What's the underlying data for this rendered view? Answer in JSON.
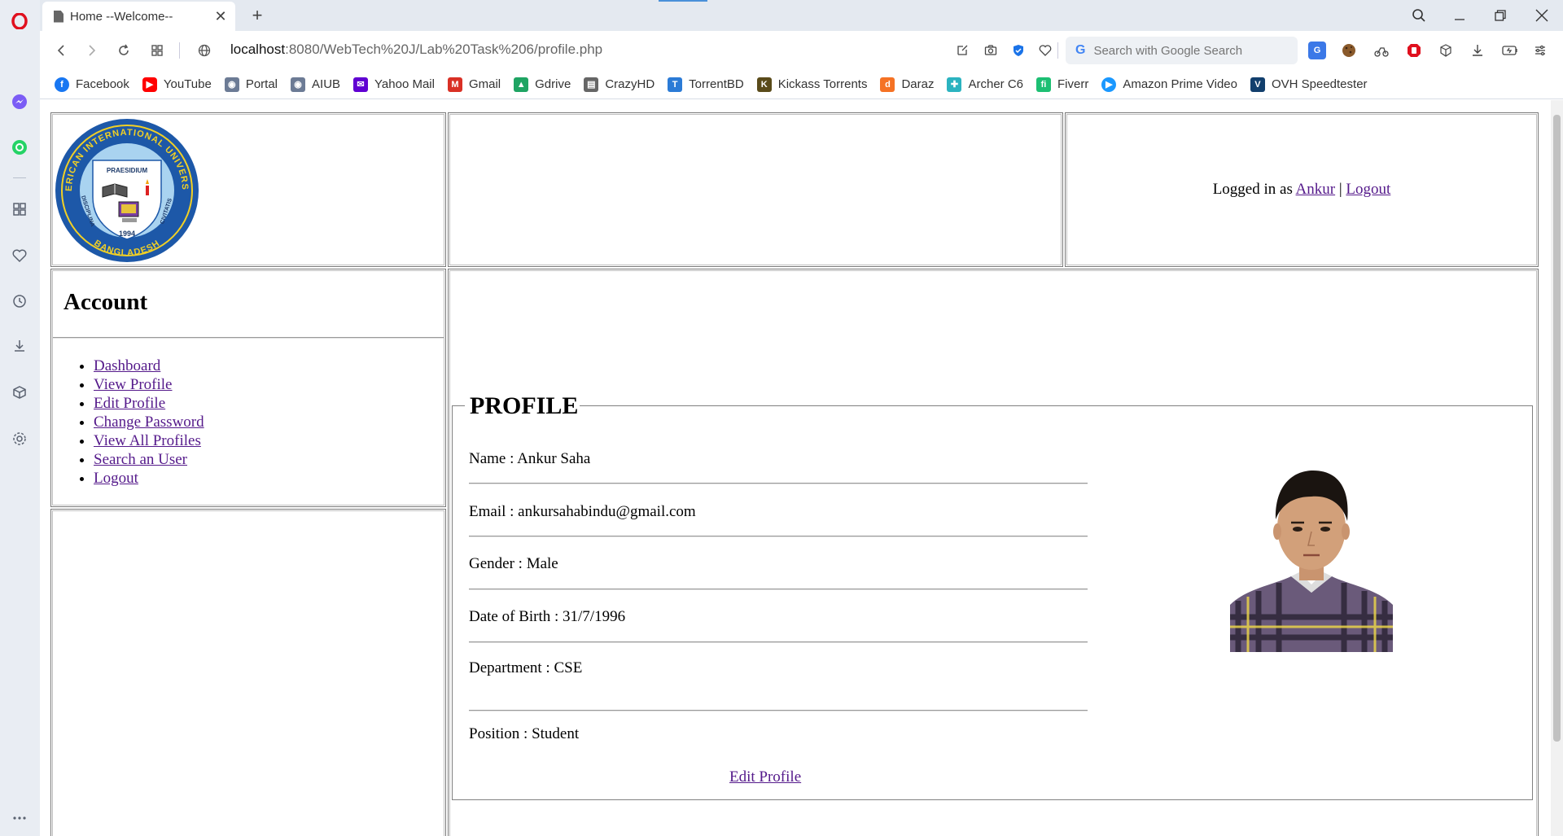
{
  "browser": {
    "tab_title": "Home --Welcome--",
    "url_host": "localhost",
    "url_path": ":8080/WebTech%20J/Lab%20Task%206/profile.php",
    "search_placeholder": "Search with Google Search",
    "accent_color": "#4a90d9"
  },
  "sidebar": {
    "icons": [
      "opera-logo-icon",
      "messenger-icon",
      "whatsapp-icon",
      "speed-dial-icon",
      "heart-icon",
      "history-icon",
      "download-icon",
      "box-icon",
      "settings-icon",
      "more-icon"
    ]
  },
  "bookmarks": [
    {
      "label": "Facebook",
      "icon": "facebook-icon",
      "color": "#1877f2"
    },
    {
      "label": "YouTube",
      "icon": "youtube-icon",
      "color": "#ff0000"
    },
    {
      "label": "Portal",
      "icon": "portal-icon",
      "color": "#6c7b95"
    },
    {
      "label": "AIUB",
      "icon": "aiub-icon",
      "color": "#6c7b95"
    },
    {
      "label": "Yahoo Mail",
      "icon": "yahoo-icon",
      "color": "#6001d2"
    },
    {
      "label": "Gmail",
      "icon": "gmail-icon",
      "color": "#d93025"
    },
    {
      "label": "Gdrive",
      "icon": "gdrive-icon",
      "color": "#1fa463"
    },
    {
      "label": "CrazyHD",
      "icon": "file-icon",
      "color": "#666666"
    },
    {
      "label": "TorrentBD",
      "icon": "torrentbd-icon",
      "color": "#2b7bd6"
    },
    {
      "label": "Kickass Torrents",
      "icon": "kickass-icon",
      "color": "#5a4b1a"
    },
    {
      "label": "Daraz",
      "icon": "daraz-icon",
      "color": "#f57224"
    },
    {
      "label": "Archer C6",
      "icon": "archer-icon",
      "color": "#2bb3c0"
    },
    {
      "label": "Fiverr",
      "icon": "fiverr-icon",
      "color": "#1dbf73"
    },
    {
      "label": "Amazon Prime Video",
      "icon": "prime-icon",
      "color": "#1a98ff"
    },
    {
      "label": "OVH Speedtester",
      "icon": "ovh-icon",
      "color": "#123f6d"
    }
  ],
  "header": {
    "logged_in_prefix": "Logged in as ",
    "username": "Ankur",
    "separator": " | ",
    "logout": "Logout"
  },
  "nav": {
    "heading": "Account",
    "items": [
      {
        "label": "Dashboard"
      },
      {
        "label": "View Profile"
      },
      {
        "label": "Edit Profile"
      },
      {
        "label": "Change Password"
      },
      {
        "label": "View All Profiles"
      },
      {
        "label": "Search an User"
      },
      {
        "label": "Logout"
      }
    ]
  },
  "profile": {
    "legend": "PROFILE",
    "name": "Name : Ankur Saha",
    "email": "Email : ankursahabindu@gmail.com",
    "gender": "Gender : Male",
    "dob": "Date of Birth : 31/7/1996",
    "department": "Department : CSE",
    "position": "Position : Student",
    "edit_link": "Edit Profile"
  },
  "logo": {
    "top_text": "AMERICAN INTERNATIONAL UNIVERSITY",
    "motto": "PRAESIDIUM",
    "left_text": "DISCIPLINA",
    "right_text": "CIVITATIS",
    "year": "1994",
    "bottom_text": "BANGLADESH"
  }
}
